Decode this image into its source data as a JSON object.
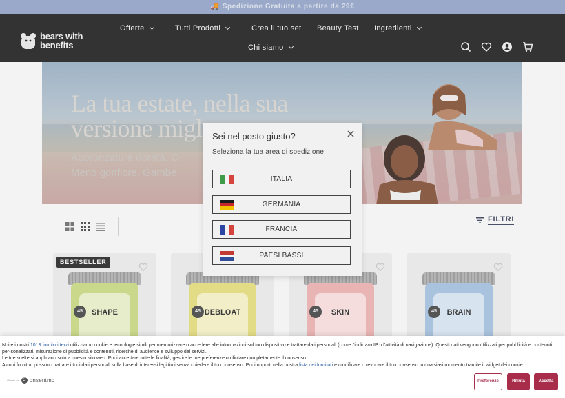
{
  "promo": {
    "text": "Spedizione Gratuita a partire da 29€"
  },
  "header": {
    "logo_text_line1": "bears with",
    "logo_text_line2": "benefits",
    "nav": [
      {
        "label": "Offerte",
        "has_dropdown": true
      },
      {
        "label": "Tutti Prodotti",
        "has_dropdown": true
      },
      {
        "label": "Crea il tuo set",
        "has_dropdown": false
      },
      {
        "label": "Beauty Test",
        "has_dropdown": false
      },
      {
        "label": "Ingredienti",
        "has_dropdown": true
      },
      {
        "label": "Chi siamo",
        "has_dropdown": true
      }
    ],
    "icons": [
      "search-icon",
      "heart-icon",
      "account-icon",
      "cart-icon"
    ]
  },
  "hero": {
    "title_line1": "La tua estate, nella sua",
    "title_line2": "versione migl",
    "text_line1": "Abbronzatura dorata. C",
    "text_line2": "Meno gonfiore. Gambe"
  },
  "toolbar": {
    "filter_label": "FILTRI"
  },
  "products": {
    "badge": "BESTSELLER",
    "items": [
      {
        "name": "SHAPE",
        "color": "#c9d88a"
      },
      {
        "name": "DEBLOAT",
        "color": "#e3dc86"
      },
      {
        "name": "SKIN",
        "color": "#e9b4b4"
      },
      {
        "name": "BRAIN",
        "color": "#a9c2dd"
      }
    ],
    "count_badge": "45"
  },
  "modal": {
    "title": "Sei nel posto giusto?",
    "subtitle": "Seleziona la tua area di spedizione.",
    "countries": [
      {
        "name": "ITALIA",
        "flag": [
          "#3f9a4a",
          "#f4f4f4",
          "#d5443d"
        ],
        "orientation": "vertical"
      },
      {
        "name": "GERMANIA",
        "flag": [
          "#1a1a1a",
          "#c8262d",
          "#f2c200"
        ],
        "orientation": "horizontal"
      },
      {
        "name": "FRANCIA",
        "flag": [
          "#2c47a3",
          "#f4f4f4",
          "#d5443d"
        ],
        "orientation": "vertical"
      },
      {
        "name": "PAESI BASSI",
        "flag": [
          "#c13a33",
          "#f4f4f4",
          "#2f4d9a"
        ],
        "orientation": "horizontal"
      }
    ]
  },
  "cookie": {
    "line1_a": "Noi e i nostri ",
    "line1_link": "1013 fornitori terzi",
    "line1_b": " utilizziamo cookie e tecnologie simili per memorizzare o accedere alle informazioni sul tuo dispositivo e trattare dati personali (come l'indirizzo IP o l'attività di navigazione). Questi dati vengono utilizzati per pubblicità e contenuti per-sonalizzati, misurazione di pubblicità e contenuti, ricerche di audience e sviluppo dei servizi.",
    "line2": "Le tue scelte si applicano solo a questo sito web. Puoi accettare tutte le finalità, gestire le tue preferenze o rifiutare completamente il consenso.",
    "line3_a": "Alcuni fornitori possono trattare i tuoi dati personali sulla base di interessi legittimi senza chiedere il tuo consenso. Puoi opporti nella nostra ",
    "line3_link": "lista dei fornitori",
    "line3_b": " e modificare o revocare il tuo consenso in qualsiasi momento tramite il widget dei cookie.",
    "powered_small": "Offerto da",
    "powered_logo": "onsentmo",
    "buttons": {
      "preferences": "Preferenze",
      "reject": "Rifiuta",
      "accept": "Accetta"
    },
    "accent": "#a72d4b"
  }
}
